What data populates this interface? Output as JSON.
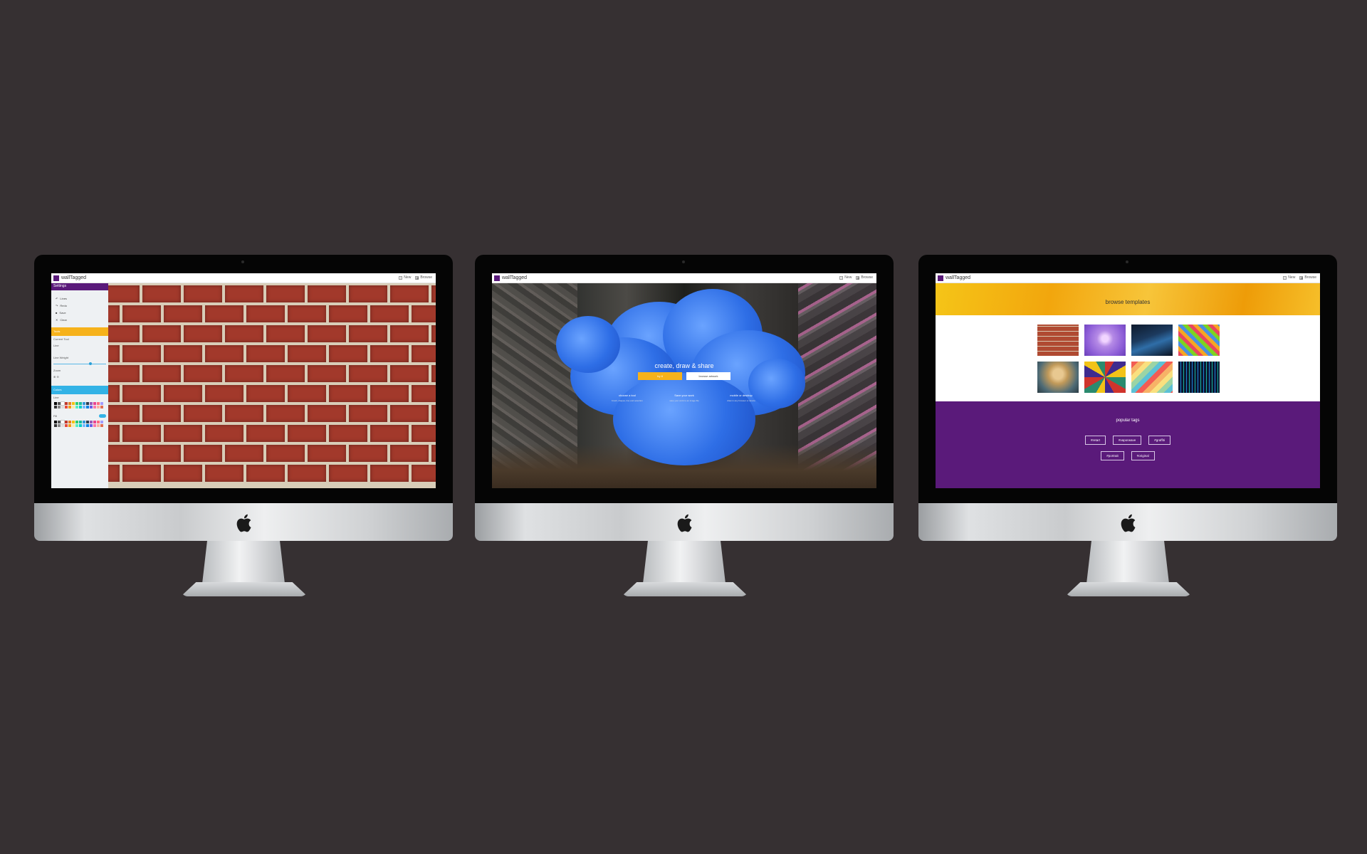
{
  "app": {
    "brand": "wallTagged",
    "nav": {
      "new_label": "New",
      "browse_label": "Browse"
    }
  },
  "screen1": {
    "panel_title": "Settings",
    "tools": [
      "Lines",
      "Redo",
      "Save",
      "Clear"
    ],
    "tools_section": "Tools",
    "draw_tool_label": "Current Tool",
    "draw_tool_value": "Line",
    "line_weight_label": "Line Weight",
    "zoom_label": "Zoom",
    "colors_section": "Colors",
    "line_label": "Line",
    "fill_label": "Fill",
    "colors": {
      "accent_purple": "#5a1a7a",
      "accent_yellow": "#f6b21b",
      "accent_blue": "#33b3e6"
    }
  },
  "screen2": {
    "title": "create, draw & share",
    "primary_button": "try it",
    "secondary_button": "browse artwork",
    "features": [
      {
        "title": "choose a tool",
        "desc": "brush, shapes, line and selection"
      },
      {
        "title": "Save your work",
        "desc": "save your work to an image file"
      },
      {
        "title": "mobile or desktop",
        "desc": "draw in any browser or device"
      }
    ]
  },
  "screen3": {
    "title": "browse templates",
    "tags_title": "popular tags",
    "tags_row1": [
      "#retart",
      "#vaporwave",
      "#graffiti"
    ],
    "tags_row2": [
      "#portrait",
      "#original"
    ]
  }
}
